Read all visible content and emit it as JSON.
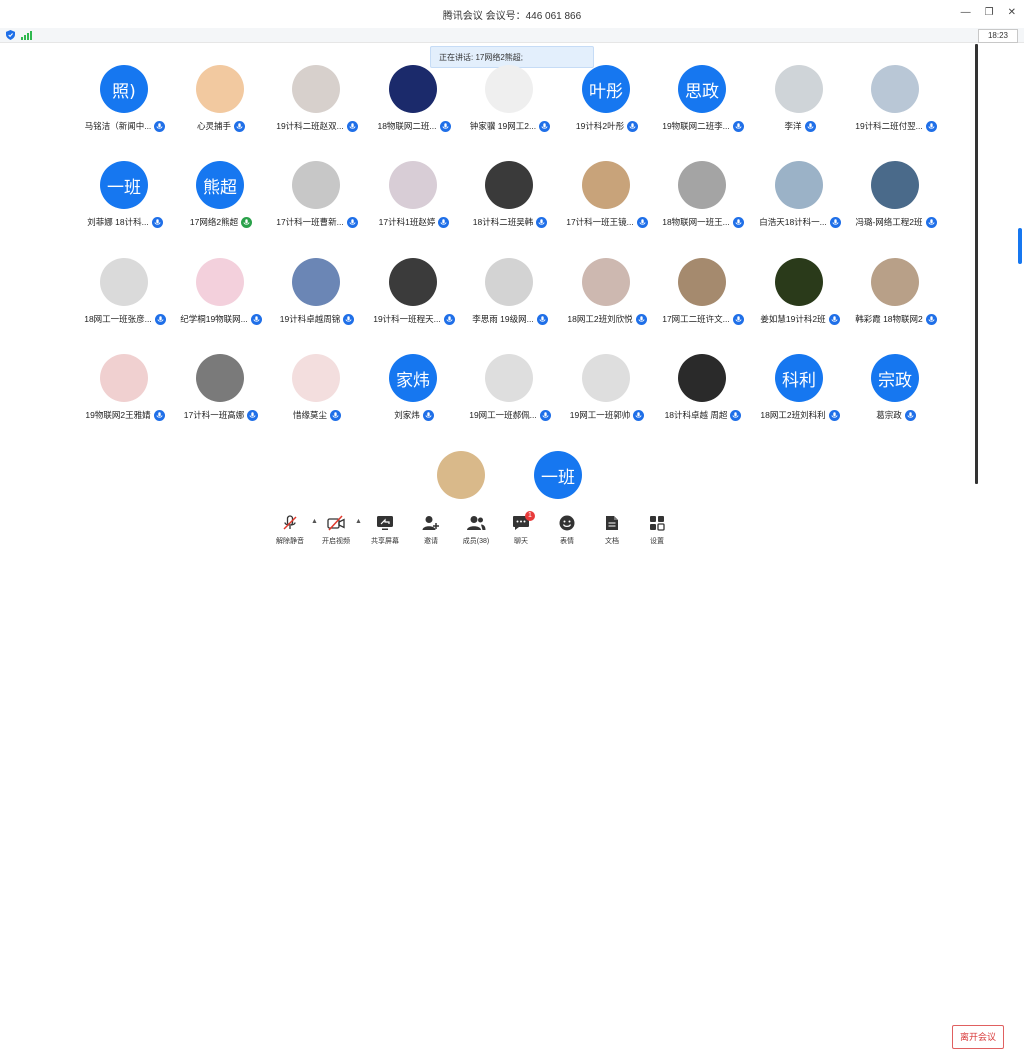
{
  "window": {
    "title": "腾讯会议 会议号：446 061 866"
  },
  "status": {
    "clock": "18:23"
  },
  "speaking": {
    "text": "正在讲话: 17网络2熊超;"
  },
  "participants": [
    {
      "name": "马铭洁（新闻中...",
      "avatar_text": "照)",
      "mic": "blue"
    },
    {
      "name": "心灵捕手",
      "avatar_text": "",
      "mic": "blue"
    },
    {
      "name": "19计科二班赵双...",
      "avatar_text": "",
      "mic": "blue"
    },
    {
      "name": "18物联网二班...",
      "avatar_text": "",
      "mic": "blue"
    },
    {
      "name": "钟家骥 19网工2...",
      "avatar_text": "",
      "mic": "blue"
    },
    {
      "name": "19计科2叶彤",
      "avatar_text": "叶彤",
      "mic": "blue"
    },
    {
      "name": "19物联网二班李...",
      "avatar_text": "思政",
      "mic": "blue"
    },
    {
      "name": "李洋",
      "avatar_text": "",
      "mic": "blue"
    },
    {
      "name": "19计科二班付翌...",
      "avatar_text": "",
      "mic": "blue"
    },
    {
      "name": "刘菲娜 18计科...",
      "avatar_text": "一班",
      "mic": "blue"
    },
    {
      "name": "17网络2熊超",
      "avatar_text": "熊超",
      "mic": "green"
    },
    {
      "name": "17计科一班曹新...",
      "avatar_text": "",
      "mic": "blue"
    },
    {
      "name": "17计科1班赵婷",
      "avatar_text": "",
      "mic": "blue"
    },
    {
      "name": "18计科二班吴韩",
      "avatar_text": "",
      "mic": "blue"
    },
    {
      "name": "17计科一班王镜...",
      "avatar_text": "",
      "mic": "blue"
    },
    {
      "name": "18物联网一班王...",
      "avatar_text": "",
      "mic": "blue"
    },
    {
      "name": "白浩天18计科一...",
      "avatar_text": "",
      "mic": "blue"
    },
    {
      "name": "冯璐-网络工程2班",
      "avatar_text": "",
      "mic": "blue"
    },
    {
      "name": "18网工一班张彦...",
      "avatar_text": "",
      "mic": "blue"
    },
    {
      "name": "纪学桐19物联网...",
      "avatar_text": "",
      "mic": "blue"
    },
    {
      "name": "19计科卓越周锦",
      "avatar_text": "",
      "mic": "blue"
    },
    {
      "name": "19计科一班程天...",
      "avatar_text": "",
      "mic": "blue"
    },
    {
      "name": "李思雨 19级网...",
      "avatar_text": "",
      "mic": "blue"
    },
    {
      "name": "18网工2班刘欣悦",
      "avatar_text": "",
      "mic": "blue"
    },
    {
      "name": "17网工二班许文...",
      "avatar_text": "",
      "mic": "blue"
    },
    {
      "name": "姜如慧19计科2班",
      "avatar_text": "",
      "mic": "blue"
    },
    {
      "name": "韩彩霞 18物联网2",
      "avatar_text": "",
      "mic": "blue"
    },
    {
      "name": "19物联网2王雅婧",
      "avatar_text": "",
      "mic": "blue"
    },
    {
      "name": "17计科一班高娜",
      "avatar_text": "",
      "mic": "blue"
    },
    {
      "name": "惜缘莫尘",
      "avatar_text": "",
      "mic": "blue"
    },
    {
      "name": "刘家炜",
      "avatar_text": "家炜",
      "mic": "blue"
    },
    {
      "name": "19网工一班郝佩...",
      "avatar_text": "",
      "mic": "blue"
    },
    {
      "name": "19网工一班郭帅",
      "avatar_text": "",
      "mic": "blue"
    },
    {
      "name": "18计科卓越 周超",
      "avatar_text": "",
      "mic": "blue"
    },
    {
      "name": "18网工2班刘科利",
      "avatar_text": "科利",
      "mic": "blue"
    },
    {
      "name": "葛宗政",
      "avatar_text": "宗政",
      "mic": "blue"
    },
    {
      "name": "",
      "avatar_text": "",
      "mic": ""
    },
    {
      "name": "",
      "avatar_text": "一班",
      "mic": ""
    }
  ],
  "toolbar": {
    "items": [
      {
        "key": "unmute",
        "label": "解除静音",
        "icon": "mic-muted-icon"
      },
      {
        "key": "video",
        "label": "开启视频",
        "icon": "camera-off-icon"
      },
      {
        "key": "share",
        "label": "共享屏幕",
        "icon": "share-screen-icon"
      },
      {
        "key": "invite",
        "label": "邀请",
        "icon": "invite-user-icon"
      },
      {
        "key": "members",
        "label": "成员(38)",
        "icon": "members-icon"
      },
      {
        "key": "chat",
        "label": "聊天",
        "icon": "chat-icon",
        "badge": "1"
      },
      {
        "key": "emoji",
        "label": "表情",
        "icon": "emoji-icon"
      },
      {
        "key": "docs",
        "label": "文档",
        "icon": "document-icon"
      },
      {
        "key": "settings",
        "label": "设置",
        "icon": "settings-grid-icon"
      }
    ],
    "leave_label": "离开会议"
  },
  "colors": {
    "accent": "#1677f0",
    "speaking_bg": "#e3effc",
    "leave": "#d83a3a",
    "mic_active": "#2aa14a"
  }
}
